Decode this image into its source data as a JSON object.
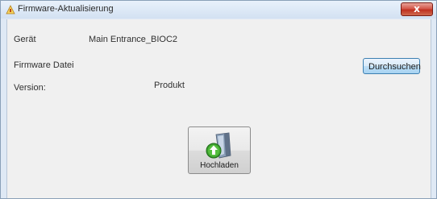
{
  "window": {
    "title": "Firmware-Aktualisierung",
    "close_label": "x"
  },
  "form": {
    "device_label": "Gerät",
    "device_value": "Main Entrance_BIOC2",
    "firmware_file_label": "Firmware Datei",
    "browse_label": "Durchsuchen",
    "version_label": "Version:",
    "product_label": "Produkt"
  },
  "upload": {
    "label": "Hochladen",
    "icon": "upload-green-arrow-icon"
  },
  "colors": {
    "titlebar": "#d3e1f2",
    "client_bg": "#f0f0f0",
    "close_red": "#c8402f",
    "browse_blue": "#bedef5",
    "upload_arrow_green": "#3da12e"
  }
}
